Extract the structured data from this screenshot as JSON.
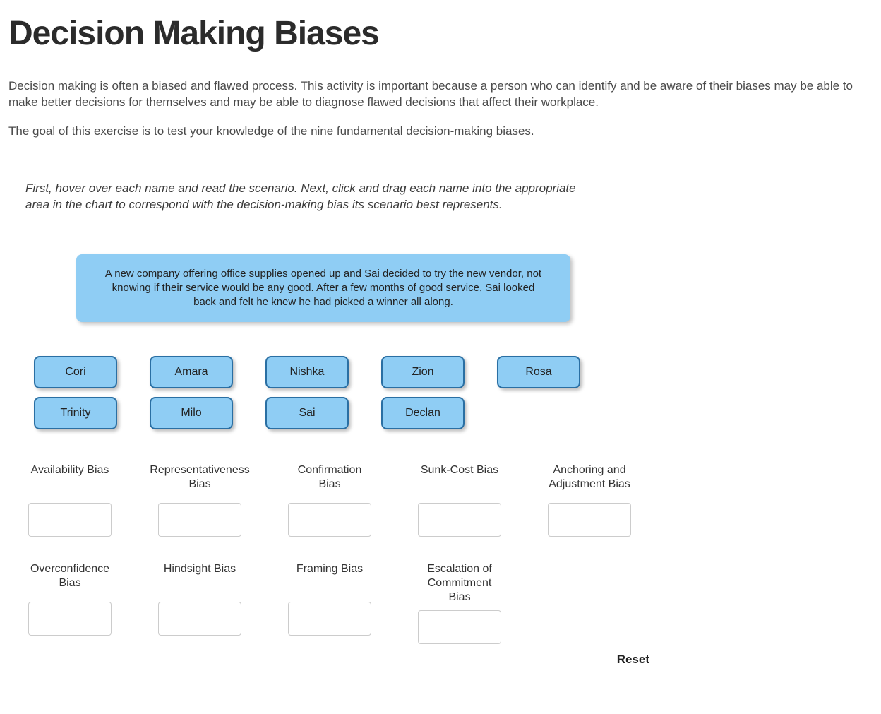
{
  "title": "Decision Making Biases",
  "intro": "Decision making is often a biased and flawed process. This activity is important because a person who can identify and be aware of their biases may be able to make better decisions for themselves and may be able to diagnose flawed decisions that affect their workplace.",
  "goal": "The goal of this exercise is to test your knowledge of the nine fundamental decision-making biases.",
  "instructions": "First, hover over each name and read the scenario. Next, click and drag each name into the appropriate area in the chart to correspond with the decision-making bias its scenario best represents.",
  "tooltip": "A new company offering office supplies opened up and Sai decided to try the new vendor, not knowing if their service would be any good. After a few months of good service, Sai looked back and felt he knew he had picked a winner all along.",
  "chips_row1": [
    "Cori",
    "Amara",
    "Nishka",
    "Zion",
    "Rosa"
  ],
  "chips_row2": [
    "Trinity",
    "Milo",
    "Sai",
    "Declan"
  ],
  "biases": [
    "Availability Bias",
    "Representativeness Bias",
    "Confirmation Bias",
    "Sunk-Cost Bias",
    "Anchoring and Adjustment Bias",
    "Overconfidence Bias",
    "Hindsight Bias",
    "Framing Bias",
    "Escalation of Commitment Bias"
  ],
  "reset_label": "Reset"
}
